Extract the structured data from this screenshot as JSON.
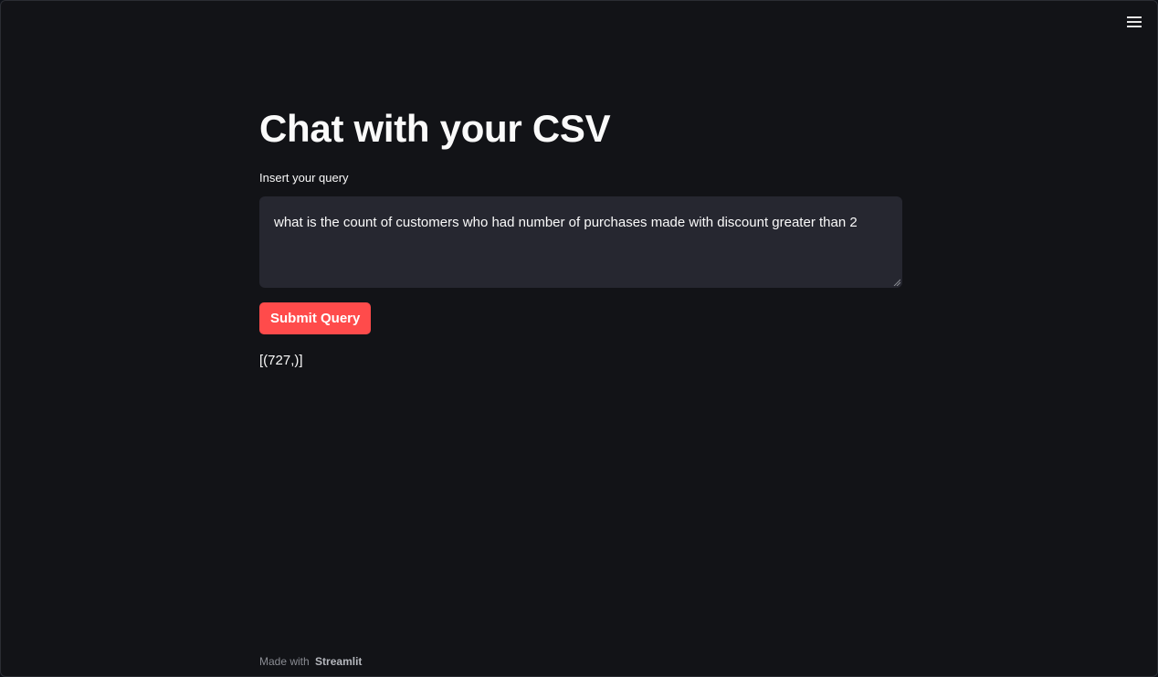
{
  "app": {
    "title": "Chat with your CSV",
    "menu_icon": "hamburger-menu-icon"
  },
  "query": {
    "label": "Insert your query",
    "value": "what is the count of customers who had number of purchases made with discount greater than 2",
    "placeholder": ""
  },
  "submit": {
    "label": "Submit Query",
    "color": "#ff4b4b"
  },
  "result": {
    "text": "[(727,)]"
  },
  "footer": {
    "prefix": "Made with",
    "brand": "Streamlit"
  },
  "colors": {
    "background": "#0e1117",
    "input_background": "#262730",
    "text": "#fafafa",
    "accent": "#ff4b4b"
  }
}
